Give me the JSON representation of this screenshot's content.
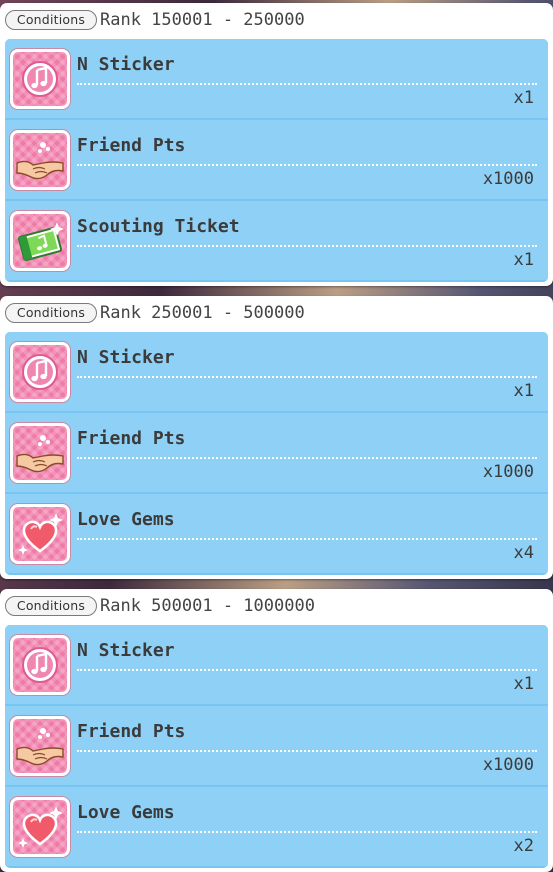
{
  "panels": [
    {
      "badge": "Conditions",
      "rank": "Rank 150001 - 250000",
      "rewards": [
        {
          "name": "N Sticker",
          "qty": "x1",
          "icon": "music-note-icon"
        },
        {
          "name": "Friend Pts",
          "qty": "x1000",
          "icon": "handshake-icon"
        },
        {
          "name": "Scouting Ticket",
          "qty": "x1",
          "icon": "scouting-ticket-icon"
        }
      ]
    },
    {
      "badge": "Conditions",
      "rank": "Rank 250001 - 500000",
      "rewards": [
        {
          "name": "N Sticker",
          "qty": "x1",
          "icon": "music-note-icon"
        },
        {
          "name": "Friend Pts",
          "qty": "x1000",
          "icon": "handshake-icon"
        },
        {
          "name": "Love Gems",
          "qty": "x4",
          "icon": "heart-gem-icon"
        }
      ]
    },
    {
      "badge": "Conditions",
      "rank": "Rank 500001 - 1000000",
      "rewards": [
        {
          "name": "N Sticker",
          "qty": "x1",
          "icon": "music-note-icon"
        },
        {
          "name": "Friend Pts",
          "qty": "x1000",
          "icon": "handshake-icon"
        },
        {
          "name": "Love Gems",
          "qty": "x2",
          "icon": "heart-gem-icon"
        }
      ]
    }
  ],
  "colors": {
    "row_bg": "#8fd1f6",
    "icon_pink": "#ef7aa7",
    "text": "#3b3b3b"
  }
}
